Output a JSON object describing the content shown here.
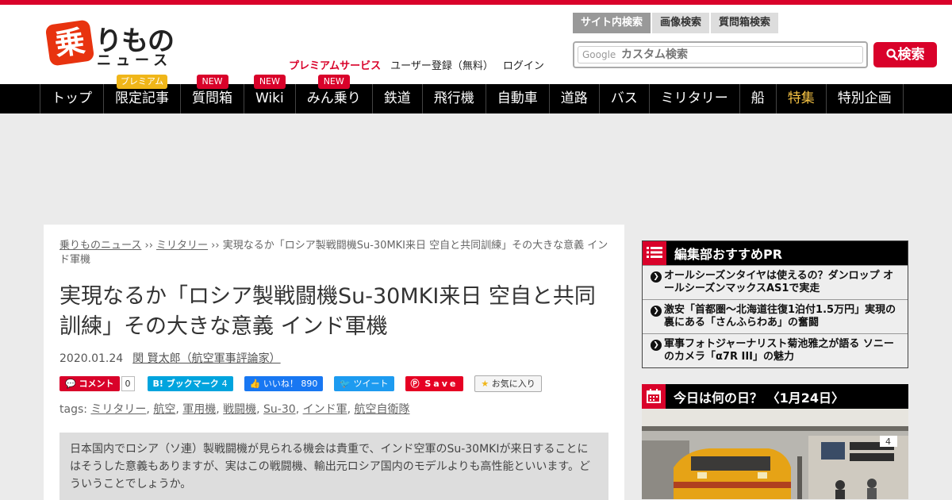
{
  "header": {
    "logo_kanji": "乗",
    "logo_text_main": "りもの",
    "logo_text_sub": "ニュース",
    "search_tabs": [
      "サイト内検索",
      "画像検索",
      "質問箱検索"
    ],
    "search_google_mark": "Google",
    "search_placeholder": "カスタム検索",
    "search_button": "検索",
    "premium_link": "プレミアムサービス",
    "register_link": "ユーザー登録（無料）",
    "login_link": "ログイン"
  },
  "nav": {
    "items": [
      {
        "label": "トップ",
        "badge": ""
      },
      {
        "label": "限定記事",
        "badge": "プレミアム"
      },
      {
        "label": "質問箱",
        "badge": "NEW"
      },
      {
        "label": "Wiki",
        "badge": "NEW"
      },
      {
        "label": "みん乗り",
        "badge": "NEW"
      },
      {
        "label": "鉄道",
        "badge": ""
      },
      {
        "label": "飛行機",
        "badge": ""
      },
      {
        "label": "自動車",
        "badge": ""
      },
      {
        "label": "道路",
        "badge": ""
      },
      {
        "label": "バス",
        "badge": ""
      },
      {
        "label": "ミリタリー",
        "badge": ""
      },
      {
        "label": "船",
        "badge": ""
      },
      {
        "label": "特集",
        "badge": ""
      },
      {
        "label": "特別企画",
        "badge": ""
      }
    ]
  },
  "article": {
    "breadcrumb": {
      "home": "乗りものニュース",
      "sep1": " ›› ",
      "category": "ミリタリー",
      "sep2": " ›› ",
      "current": "実現なるか「ロシア製戦闘機Su-30MKI来日 空自と共同訓練」その大きな意義 インド軍機"
    },
    "title": "実現なるか「ロシア製戦闘機Su-30MKI来日 空自と共同訓練」その大きな意義 インド軍機",
    "date": "2020.01.24",
    "author": "関 賢太郎（航空軍事評論家）",
    "share": {
      "comment_label": "コメント",
      "comment_count": "0",
      "hatena_label": "B! ブックマーク",
      "hatena_count": "4",
      "fb_label": "いいね！ 890",
      "tw_label": "ツイート",
      "pin_label": "Save",
      "fav_label": "お気に入り"
    },
    "tags_label": "tags:",
    "tags": [
      "ミリタリー",
      "航空",
      "軍用機",
      "戦闘機",
      "Su-30",
      "インド軍",
      "航空自衛隊"
    ],
    "lead": "日本国内でロシア（ソ連）製戦闘機が見られる機会は貴重で、インド空軍のSu-30MKIが来日することにはそうした意義もありますが、実はこの戦闘機、輸出元ロシア国内のモデルよりも高性能といいます。どういうことでしょうか。"
  },
  "sidebar": {
    "pr_title": "編集部おすすめPR",
    "pr_items": [
      "オールシーズンタイヤは使えるの？ダンロップ オールシーズンマックスAS1で実走",
      "激安「首都圏～北海道往復1泊付1.5万円」実現の裏にある「さんふらわあ」の奮闘",
      "軍事フォトジャーナリスト菊池雅之が語る ソニーのカメラ「α7R III」の魅力"
    ],
    "today_title": "今日は何の日？ 〈1月24日〉",
    "photo_platform_number": "4"
  },
  "colors": {
    "brand_red": "#d9022a",
    "nav_bg": "#000000",
    "premium_badge": "#f0b619",
    "feature_link": "#f6c344"
  }
}
